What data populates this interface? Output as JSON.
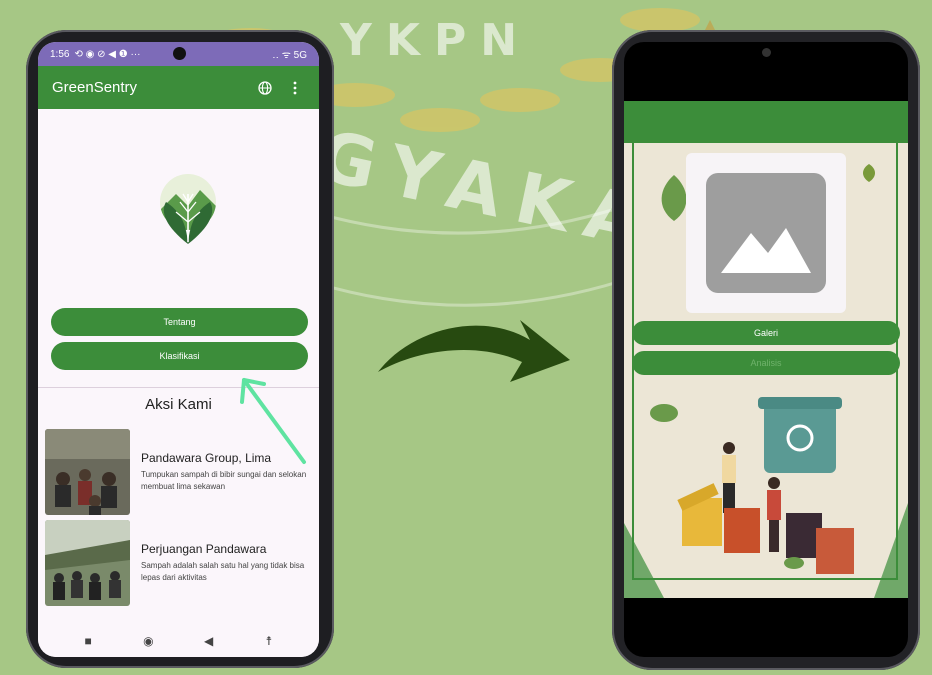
{
  "watermark": {
    "top_text": "YKPN",
    "arc_text": "YOGYAKARTA"
  },
  "phone_left": {
    "status": {
      "time": "1:56",
      "left_icons": "⟲ ◉ ⊘ ◀ ❶ ···",
      "right_icons": "‥ ᯤ 5G"
    },
    "app_title": "GreenSentry",
    "globe_icon": "globe-icon",
    "menu_icon": "more-vert-icon",
    "buttons": {
      "tentang": "Tentang",
      "klasifikasi": "Klasifikasi"
    },
    "section_title": "Aksi Kami",
    "cards": [
      {
        "title": "Pandawara Group, Lima",
        "desc": "Tumpukan sampah di bibir sungai dan selokan membuat lima sekawan"
      },
      {
        "title": "Perjuangan Pandawara",
        "desc": "Sampah adalah salah satu hal yang tidak bisa lepas dari aktivitas"
      }
    ],
    "nav": {
      "square": "■",
      "home": "◉",
      "back": "◀",
      "accessibility": "☨"
    }
  },
  "phone_right": {
    "image_placeholder": "image-icon",
    "buttons": {
      "galeri": "Galeri",
      "analisis": "Analisis"
    }
  },
  "colors": {
    "bg": "#a6c785",
    "primary": "#3c8d3a",
    "status_bar": "#7d6bb8",
    "arrow": "#274a10",
    "pointer": "#5fe3a1"
  }
}
